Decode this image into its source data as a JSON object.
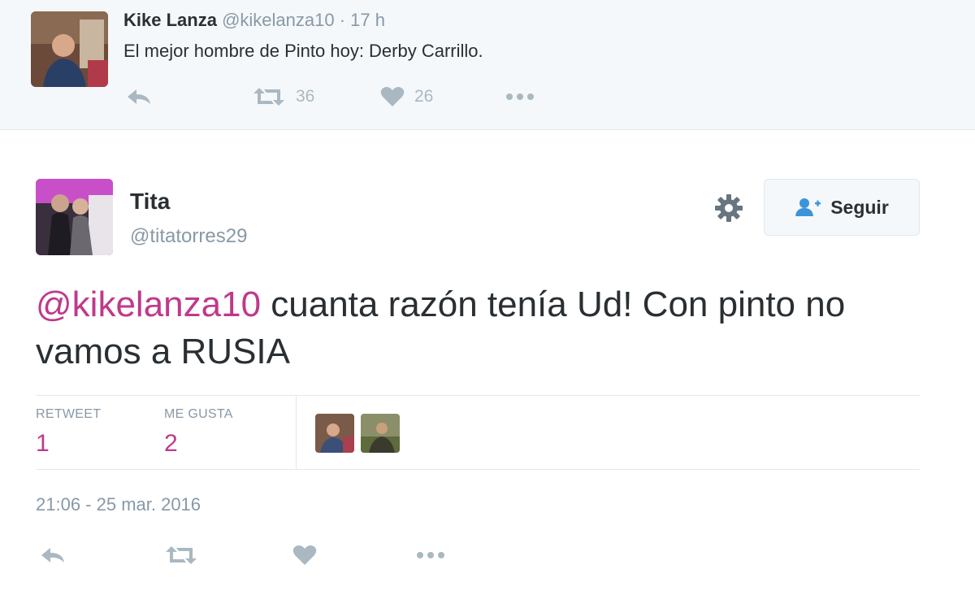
{
  "parent_tweet": {
    "name": "Kike Lanza",
    "handle": "@kikelanza10",
    "separator": "·",
    "time": "17 h",
    "text": "El mejor hombre de Pinto hoy: Derby Carrillo.",
    "retweet_count": "36",
    "like_count": "26"
  },
  "main_tweet": {
    "name": "Tita",
    "handle": "@titatorres29",
    "follow_label": "Seguir",
    "mention": "@kikelanza10",
    "text": " cuanta razón tenía Ud! Con pinto no vamos a RUSIA",
    "stats": {
      "retweet_label": "RETWEET",
      "retweet_value": "1",
      "like_label": "ME GUSTA",
      "like_value": "2"
    },
    "timestamp": "21:06 - 25 mar. 2016"
  },
  "icons": {
    "reply": "reply-icon",
    "retweet": "retweet-icon",
    "like": "heart-icon",
    "more": "more-icon",
    "settings": "gear-icon",
    "follow": "add-user-icon"
  },
  "colors": {
    "accent": "#c0398a",
    "muted": "#8899a6",
    "icon": "#aab8c2",
    "follow_icon": "#3b94d9"
  }
}
